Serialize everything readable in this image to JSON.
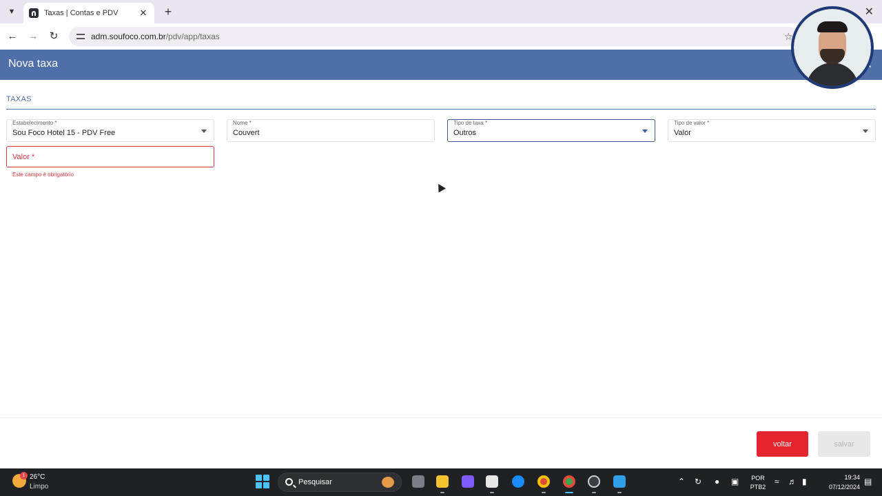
{
  "browser": {
    "tab_title": "Taxas | Contas e PDV",
    "url_host": "adm.soufoco.com.br",
    "url_path": "/pdv/app/taxas"
  },
  "app": {
    "header_title": "Nova taxa",
    "section_title": "TAXAS"
  },
  "form": {
    "estabelecimento": {
      "label": "Estabelecimento *",
      "value": "Sou Foco Hotel 15 - PDV Free"
    },
    "nome": {
      "label": "Nome *",
      "value": "Couvert"
    },
    "tipo_taxa": {
      "label": "Tipo de taxa *",
      "value": "Outros"
    },
    "tipo_valor": {
      "label": "Tipo de valor *",
      "value": "Valor"
    },
    "valor": {
      "placeholder": "Valor *",
      "error": "Este campo é obrigatório"
    }
  },
  "actions": {
    "back_label": "voltar",
    "save_label": "salvar"
  },
  "taskbar": {
    "temperature": "26°C",
    "condition": "Limpo",
    "weather_badge": "1",
    "search_placeholder": "Pesquisar",
    "lang_line1": "POR",
    "lang_line2": "PTB2",
    "time": "19:34",
    "date": "07/12/2024"
  },
  "colors": {
    "header": "#4f6fa9",
    "accent": "#3f5a91",
    "error": "#d9383e",
    "danger_button": "#e4252f"
  },
  "icons": [
    "chevron-down-icon",
    "close-icon",
    "plus-icon",
    "back-arrow-icon",
    "forward-arrow-icon",
    "reload-icon",
    "site-info-icon",
    "star-icon",
    "dropdown-caret-icon",
    "search-icon",
    "windows-start-icon",
    "wifi-icon",
    "volume-icon",
    "battery-icon"
  ]
}
